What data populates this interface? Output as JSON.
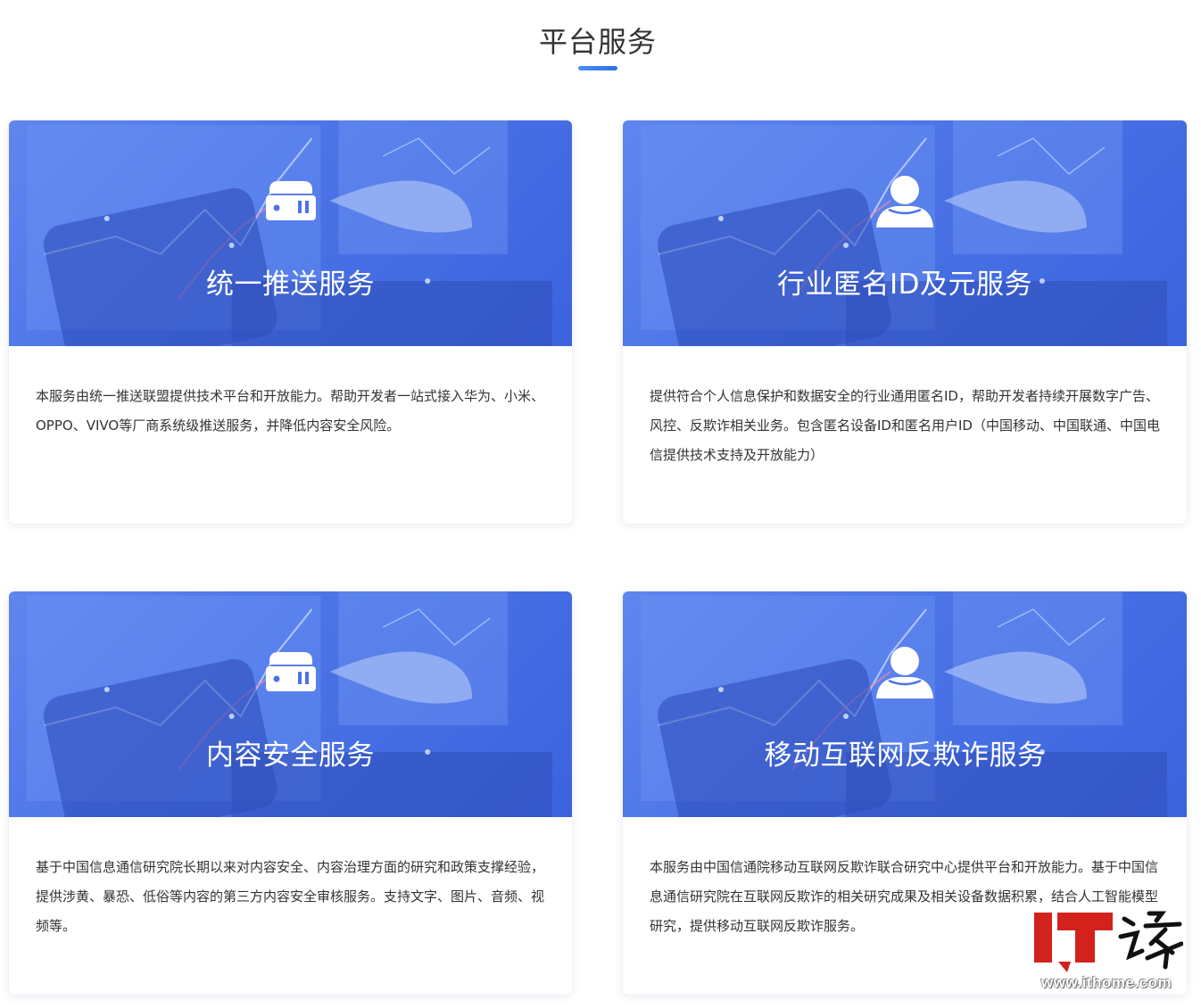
{
  "section": {
    "title": "平台服务"
  },
  "cards": [
    {
      "title": "统一推送服务",
      "icon": "server-box-icon",
      "description": "本服务由统一推送联盟提供技术平台和开放能力。帮助开发者一站式接入华为、小米、OPPO、VIVO等厂商系统级推送服务，并降低内容安全风险。"
    },
    {
      "title": "行业匿名ID及元服务",
      "icon": "user-icon",
      "description": "提供符合个人信息保护和数据安全的行业通用匿名ID，帮助开发者持续开展数字广告、风控、反欺诈相关业务。包含匿名设备ID和匿名用户ID（中国移动、中国联通、中国电信提供技术支持及开放能力）"
    },
    {
      "title": "内容安全服务",
      "icon": "server-box-icon",
      "description": "基于中国信息通信研究院长期以来对内容安全、内容治理方面的研究和政策支撑经验，提供涉黄、暴恐、低俗等内容的第三方内容安全审核服务。支持文字、图片、音频、视频等。"
    },
    {
      "title": "移动互联网反欺诈服务",
      "icon": "user-icon",
      "description": "本服务由中国信通院移动互联网反欺诈联合研究中心提供平台和开放能力。基于中国信息通信研究院在互联网反欺诈的相关研究成果及相关设备数据积累，结合人工智能模型研究，提供移动互联网反欺诈服务。"
    }
  ],
  "watermark": {
    "url": "www.ithome.com"
  },
  "colors": {
    "accent": "#3b72ea",
    "banner": "#4b73e6",
    "logo_red": "#d2221b"
  }
}
